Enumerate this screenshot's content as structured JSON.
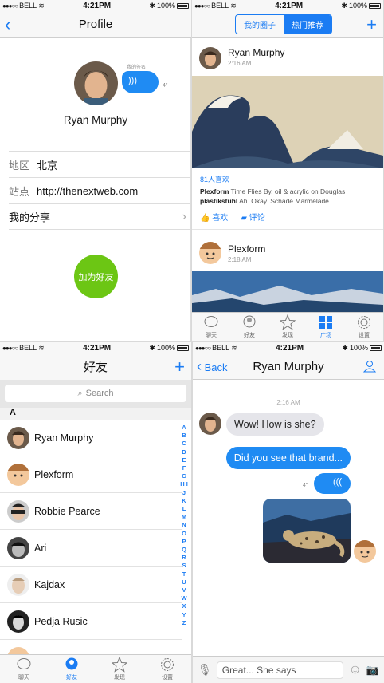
{
  "status": {
    "carrier": "BELL",
    "time": "4:21PM",
    "battery": "100%"
  },
  "profile": {
    "title": "Profile",
    "signature_label": "我的签名",
    "voice_duration": "4\"",
    "name": "Ryan Murphy",
    "region_key": "地区",
    "region_value": "北京",
    "site_key": "站点",
    "site_value": "http://thenextweb.com",
    "share_label": "我的分享",
    "add_friend": "加为好友"
  },
  "feed": {
    "seg": [
      "我的圈子",
      "热门推荐"
    ],
    "post1": {
      "author": "Ryan Murphy",
      "time": "2:16 AM",
      "likes": "81人喜欢",
      "caption_author": "Plexform",
      "caption_text": "Time Flies By, oil & acrylic on Douglas",
      "comment_author": "plastikstuhl",
      "comment_text": "Ah. Okay. Schade Marmelade.",
      "like_btn": "喜欢",
      "comment_btn": "评论"
    },
    "post2": {
      "author": "Plexform",
      "time": "2:18 AM"
    }
  },
  "tabs": [
    "聊天",
    "好友",
    "发现",
    "广场",
    "设置"
  ],
  "contacts": {
    "title": "好友",
    "search_placeholder": "Search",
    "section": "A",
    "items": [
      "Ryan Murphy",
      "Plexform",
      "Robbie Pearce",
      "Ari",
      "Kajdax",
      "Pedja Rusic"
    ],
    "index": "A B C D E F G H I J K L M N O P Q R S T U V W X Y Z"
  },
  "chat": {
    "back": "Back",
    "title": "Ryan Murphy",
    "time": "2:16 AM",
    "msg1": "Wow! How is she?",
    "msg2": "Did you see that brand...",
    "voice_duration": "4\"",
    "input_placeholder": "Great... She says"
  },
  "colors": {
    "accent": "#1b7cf3",
    "add_button": "#6cc614"
  }
}
